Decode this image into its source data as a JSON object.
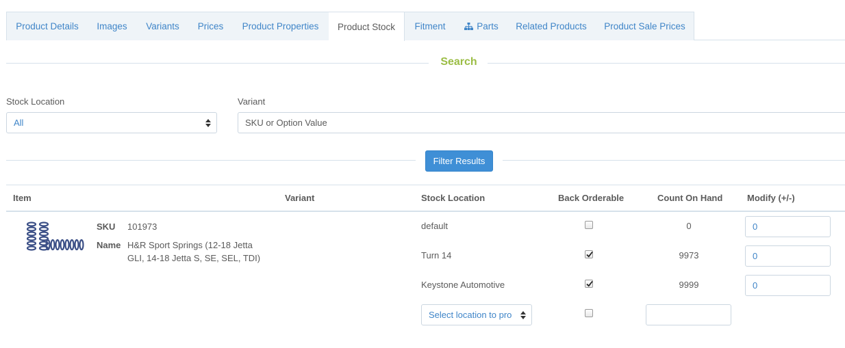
{
  "tabs": [
    {
      "label": "Product Details"
    },
    {
      "label": "Images"
    },
    {
      "label": "Variants"
    },
    {
      "label": "Prices"
    },
    {
      "label": "Product Properties"
    },
    {
      "label": "Product Stock",
      "active": true
    },
    {
      "label": "Fitment"
    },
    {
      "label": "Parts",
      "icon": "sitemap-icon"
    },
    {
      "label": "Related Products"
    },
    {
      "label": "Product Sale Prices"
    }
  ],
  "search": {
    "heading": "Search",
    "stock_location_label": "Stock Location",
    "stock_location_value": "All",
    "variant_label": "Variant",
    "variant_placeholder": "SKU or Option Value",
    "filter_button": "Filter Results"
  },
  "table": {
    "headers": {
      "item": "Item",
      "variant": "Variant",
      "stock_location": "Stock Location",
      "back_orderable": "Back Orderable",
      "count_on_hand": "Count On Hand",
      "modify": "Modify (+/-)"
    },
    "item": {
      "sku_label": "SKU",
      "sku": "101973",
      "name_label": "Name",
      "name_line1": "H&R Sport Springs (12-18 Jetta",
      "name_line2": "GLI, 14-18 Jetta S, SE, SEL, TDI)"
    },
    "rows": [
      {
        "location": "default",
        "back_orderable": false,
        "count": "0",
        "modify": "0"
      },
      {
        "location": "Turn 14",
        "back_orderable": true,
        "count": "9973",
        "modify": "0"
      },
      {
        "location": "Keystone Automotive",
        "back_orderable": true,
        "count": "9999",
        "modify": "0"
      }
    ],
    "new_row": {
      "location_select": "Select location to pro",
      "back_orderable": false,
      "count": ""
    }
  },
  "colors": {
    "accent": "#3f85c8",
    "heading_green": "#9bbd45",
    "button_blue": "#3f8fd6",
    "border": "#d6e1ea"
  }
}
